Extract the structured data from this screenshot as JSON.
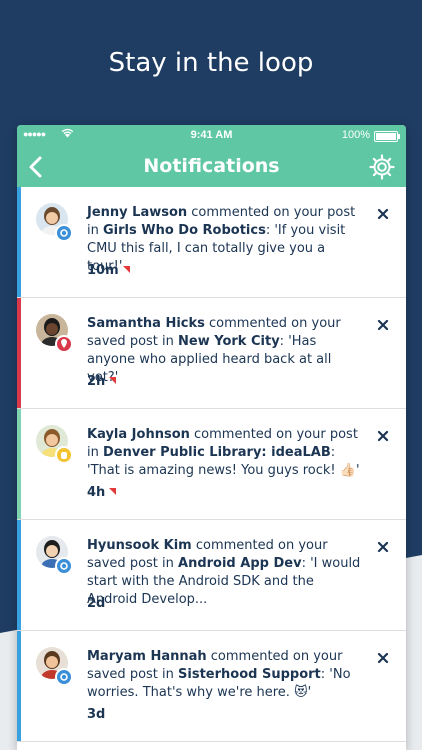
{
  "promo": {
    "title": "Stay in the loop"
  },
  "status_bar": {
    "time": "9:41 AM",
    "battery": "100%",
    "signal": "●●●●●"
  },
  "nav": {
    "title": "Notifications"
  },
  "colors": {
    "header": "#5fc7a3",
    "background": "#1f3d63",
    "accent_blue": "#3aa1e0",
    "accent_red": "#d9374a",
    "accent_green": "#7fd3b0"
  },
  "notifications": [
    {
      "name": "Jenny Lawson",
      "action": " commented on your post in ",
      "group": "Girls Who Do Robotics",
      "sep": ": ",
      "message": "'If you visit CMU this fall, I can totally give you a tour!'",
      "time": "10m",
      "flagged": true,
      "accent": "#3aa1e0",
      "badge_icon": "gear-badge-icon",
      "avatar_icon": "avatar-jenny"
    },
    {
      "name": "Samantha Hicks",
      "action": " commented on your saved post in ",
      "group": "New York City",
      "sep": ": ",
      "message": "'Has anyone who applied heard back at all yet?'",
      "time": "2h",
      "flagged": true,
      "accent": "#d9374a",
      "badge_icon": "location-pin-icon",
      "avatar_icon": "avatar-samantha"
    },
    {
      "name": "Kayla Johnson",
      "action": " commented on your post in ",
      "group": "Denver Public Library: ideaLAB",
      "sep": ": ",
      "message": "'That is amazing news! You guys rock! 👍🏻'",
      "time": "4h",
      "flagged": true,
      "accent": "#7fd3b0",
      "badge_icon": "hand-badge-icon",
      "avatar_icon": "avatar-kayla"
    },
    {
      "name": "Hyunsook Kim",
      "action": " commented on your saved post in ",
      "group": "Android App Dev",
      "sep": ": ",
      "message": "'I would start with the Android SDK and the Android Develop...",
      "time": "2d",
      "flagged": false,
      "accent": "#3aa1e0",
      "badge_icon": "gear-badge-icon",
      "avatar_icon": "avatar-hyunsook"
    },
    {
      "name": "Maryam Hannah",
      "action": " commented on your saved post in ",
      "group": "Sisterhood Support",
      "sep": ": ",
      "message": "'No worries. That's why we're here. 😻'",
      "time": "3d",
      "flagged": false,
      "accent": "#3aa1e0",
      "badge_icon": "gear-badge-icon",
      "avatar_icon": "avatar-maryam"
    }
  ]
}
